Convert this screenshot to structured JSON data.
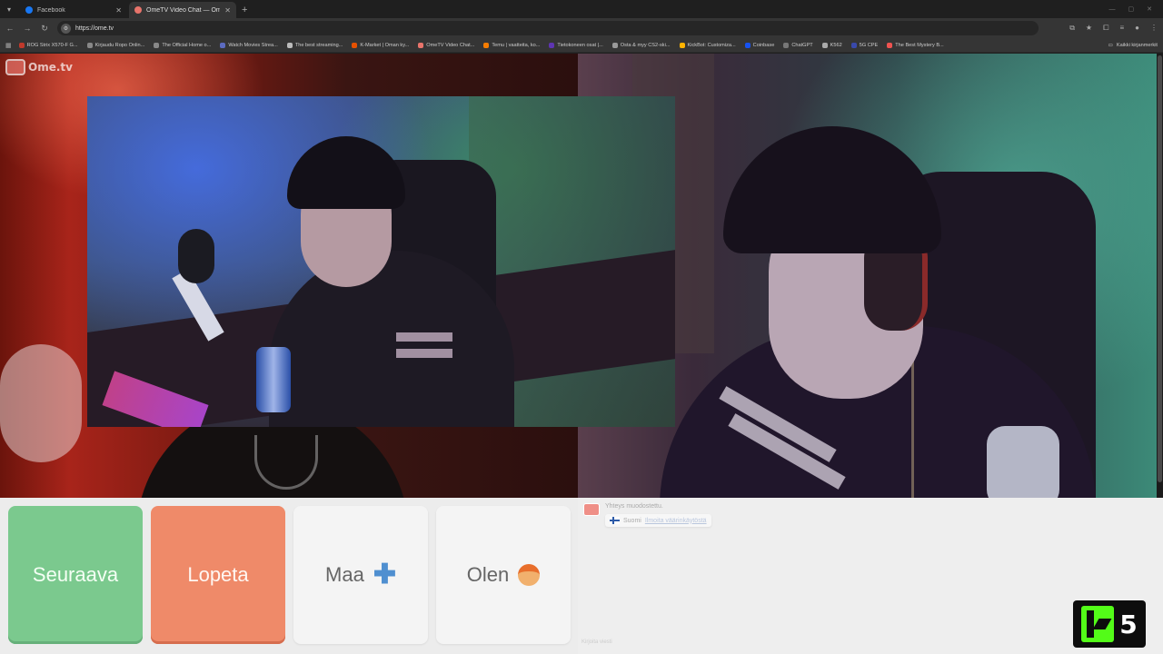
{
  "browser": {
    "tabs": [
      {
        "title": "Facebook",
        "fav_color": "#1877f2",
        "active": false
      },
      {
        "title": "OmeTV Video Chat — Ome",
        "fav_color": "#e8746b",
        "active": true
      }
    ],
    "url": "https://ome.tv",
    "bookmarks": [
      {
        "label": "ROG Strix X570-F G...",
        "icon_color": "#c0392b"
      },
      {
        "label": "Kirjaudu Ropo Onlin...",
        "icon_color": "#888888"
      },
      {
        "label": "The Official Home o...",
        "icon_color": "#888888"
      },
      {
        "label": "Watch Movies Strea...",
        "icon_color": "#5c6bc0"
      },
      {
        "label": "The best streaming...",
        "icon_color": "#bbbbbb"
      },
      {
        "label": "K-Market | Oman ky...",
        "icon_color": "#e65100"
      },
      {
        "label": "OmeTV Video Chat...",
        "icon_color": "#e8746b"
      },
      {
        "label": "Temu | vaatteita, ko...",
        "icon_color": "#f57c00"
      },
      {
        "label": "Tietokoneen osat |...",
        "icon_color": "#5e35b1"
      },
      {
        "label": "Osta & myy CS2-ski...",
        "icon_color": "#999999"
      },
      {
        "label": "KickBot: Customiza...",
        "icon_color": "#ffb300"
      },
      {
        "label": "Coinbase",
        "icon_color": "#1652f0"
      },
      {
        "label": "ChatGPT",
        "icon_color": "#777777"
      },
      {
        "label": "K562",
        "icon_color": "#aaaaaa"
      },
      {
        "label": "5G CPE",
        "icon_color": "#3949ab"
      },
      {
        "label": "The Best Mystery B...",
        "icon_color": "#ef5350"
      }
    ],
    "bookmarks_right": "Kaikki kirjanmerkit"
  },
  "site": {
    "logo_text": "Ome.tv"
  },
  "controls": {
    "next_label": "Seuraava",
    "stop_label": "Lopeta",
    "country_label": "Maa",
    "gender_label": "Olen"
  },
  "chat": {
    "status_text": "Yhteys muodostettu.",
    "country_name": "Suomi",
    "country_link": "Ilmoita väärinkäytöstä",
    "input_placeholder": "Kirjoita viesti"
  },
  "badge": {
    "number": "5"
  }
}
